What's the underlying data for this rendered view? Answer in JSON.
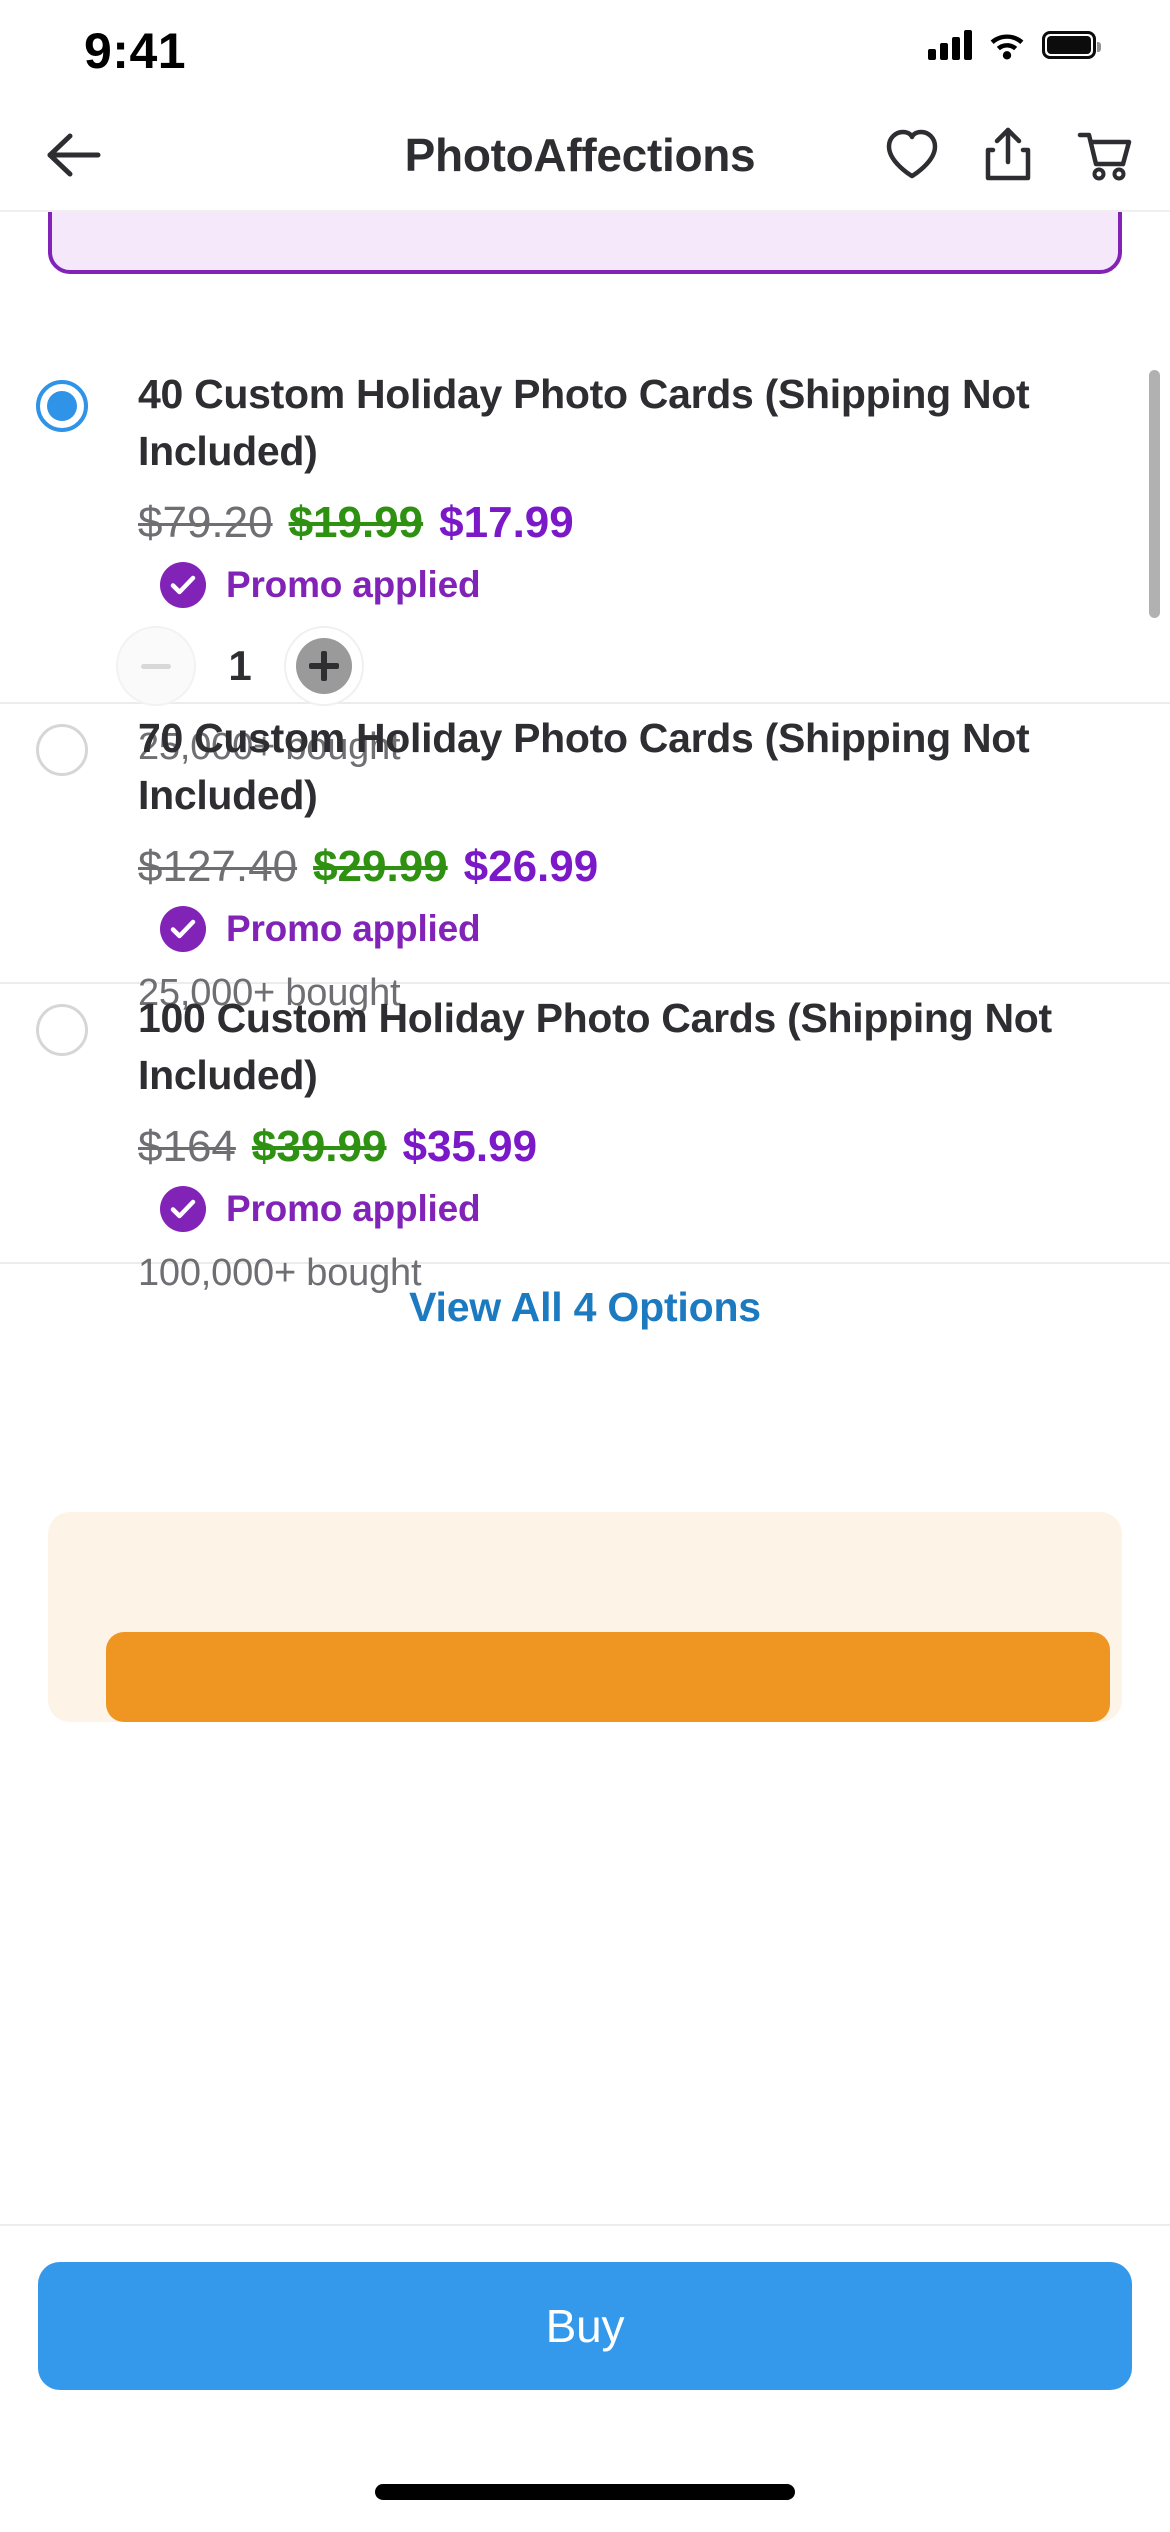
{
  "status_bar": {
    "time": "9:41",
    "cellular_icon": "signal-bars-icon",
    "wifi_icon": "wifi-icon",
    "battery_icon": "battery-full-icon"
  },
  "nav_bar": {
    "back_icon": "arrow-left-icon",
    "title": "PhotoAffections",
    "favorite_icon": "heart-icon",
    "share_icon": "share-icon",
    "cart_icon": "shopping-cart-icon"
  },
  "colors": {
    "accent_blue": "#3498eb",
    "link_blue": "#1c7ac0",
    "promo_purple": "#8223b8",
    "final_price_purple": "#7b19c9",
    "sale_green": "#2f9111",
    "orig_gray": "#6e6e73",
    "orange_bar": "#ef9522",
    "orange_card": "#fdf3e7",
    "promo_card_bg": "#f6e8fb",
    "radio_selected": "#2f93e8"
  },
  "options": [
    {
      "selected": true,
      "title": "40 Custom Holiday Photo Cards (Shipping Not Included)",
      "price_original": "$79.20",
      "price_sale": "$19.99",
      "price_final": "$17.99",
      "promo_label": "Promo applied",
      "promo_check_icon": "check-circle-icon",
      "quantity": "1",
      "decrement_icon": "minus-icon",
      "increment_icon": "plus-icon",
      "bought": "25,000+ bought"
    },
    {
      "selected": false,
      "title": "70 Custom Holiday Photo Cards (Shipping Not Included)",
      "price_original": "$127.40",
      "price_sale": "$29.99",
      "price_final": "$26.99",
      "promo_label": "Promo applied",
      "promo_check_icon": "check-circle-icon",
      "bought": "25,000+ bought"
    },
    {
      "selected": false,
      "title": "100 Custom Holiday Photo Cards (Shipping Not Included)",
      "price_original": "$164",
      "price_sale": "$39.99",
      "price_final": "$35.99",
      "promo_label": "Promo applied",
      "promo_check_icon": "check-circle-icon",
      "bought": "100,000+ bought"
    }
  ],
  "view_all": {
    "label": "View All 4 Options"
  },
  "footer": {
    "buy_label": "Buy",
    "home_indicator": "home-indicator"
  }
}
